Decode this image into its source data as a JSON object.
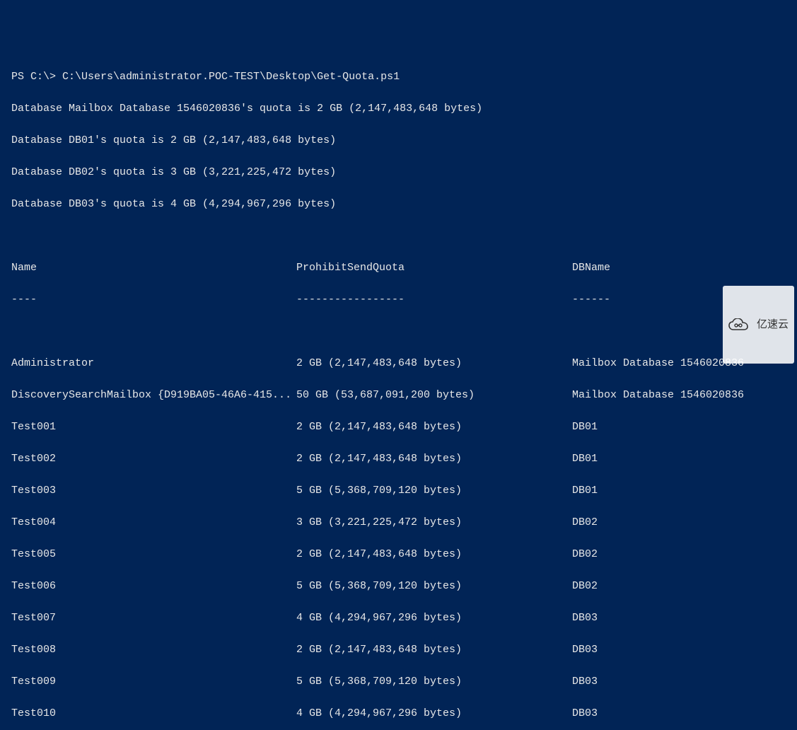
{
  "prompt": {
    "ps": "PS C:\\> ",
    "command": "C:\\Users\\administrator.POC-TEST\\Desktop\\Get-Quota.ps1"
  },
  "db_lines": [
    "Database Mailbox Database 1546020836's quota is 2 GB (2,147,483,648 bytes)",
    "Database DB01's quota is 2 GB (2,147,483,648 bytes)",
    "Database DB02's quota is 3 GB (3,221,225,472 bytes)",
    "Database DB03's quota is 4 GB (4,294,967,296 bytes)"
  ],
  "headers": {
    "name": "Name",
    "quota": "ProhibitSendQuota",
    "db": "DBName"
  },
  "underlines": {
    "name": "----",
    "quota": "-----------------",
    "db": "------"
  },
  "rows": [
    {
      "name": "Administrator",
      "quota": "2 GB (2,147,483,648 bytes)",
      "db": "Mailbox Database 1546020836"
    },
    {
      "name": "DiscoverySearchMailbox {D919BA05-46A6-415...",
      "quota": "50 GB (53,687,091,200 bytes)",
      "db": "Mailbox Database 1546020836"
    },
    {
      "name": "Test001",
      "quota": "2 GB (2,147,483,648 bytes)",
      "db": "DB01"
    },
    {
      "name": "Test002",
      "quota": "2 GB (2,147,483,648 bytes)",
      "db": "DB01"
    },
    {
      "name": "Test003",
      "quota": "5 GB (5,368,709,120 bytes)",
      "db": "DB01"
    },
    {
      "name": "Test004",
      "quota": "3 GB (3,221,225,472 bytes)",
      "db": "DB02"
    },
    {
      "name": "Test005",
      "quota": "2 GB (2,147,483,648 bytes)",
      "db": "DB02"
    },
    {
      "name": "Test006",
      "quota": "5 GB (5,368,709,120 bytes)",
      "db": "DB02"
    },
    {
      "name": "Test007",
      "quota": "4 GB (4,294,967,296 bytes)",
      "db": "DB03"
    },
    {
      "name": "Test008",
      "quota": "2 GB (2,147,483,648 bytes)",
      "db": "DB03"
    },
    {
      "name": "Test009",
      "quota": "5 GB (5,368,709,120 bytes)",
      "db": "DB03"
    },
    {
      "name": "Test010",
      "quota": "4 GB (4,294,967,296 bytes)",
      "db": "DB03"
    }
  ],
  "watermark": {
    "text": "亿速云"
  }
}
